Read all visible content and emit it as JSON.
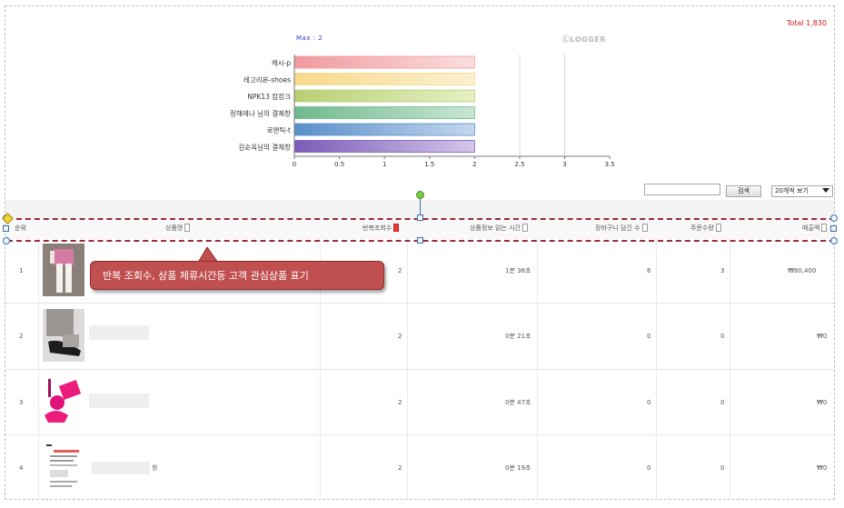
{
  "header": {
    "total": "Total 1,830",
    "max": "Max : 2",
    "logo": "LOGGER"
  },
  "chart_data": {
    "type": "bar",
    "orientation": "horizontal",
    "categories": [
      "캐시-p",
      "레고리본-shoes",
      "NPK13 캄캉크",
      "장해레나 님의 결제창",
      "로맨틱-t",
      "김순옥님의 결제창"
    ],
    "values": [
      2,
      2,
      2,
      2,
      2,
      2
    ],
    "xticks": [
      "0",
      "0.5",
      "1",
      "1.5",
      "2",
      "2.5",
      "3",
      "3.5"
    ],
    "xlim": [
      0,
      3.5
    ],
    "colors": [
      [
        "#f09a9e",
        "#fbdede"
      ],
      [
        "#f7d98a",
        "#fcf0cf"
      ],
      [
        "#b9cf73",
        "#e5efc3"
      ],
      [
        "#6fb98d",
        "#c9e6d3"
      ],
      [
        "#5a8ec9",
        "#c3d7ee"
      ],
      [
        "#7a5bb8",
        "#d5c7ea"
      ]
    ]
  },
  "controls": {
    "search_value": "",
    "search_button": "검색",
    "view_select": "20개씩 보기"
  },
  "table": {
    "columns": [
      "순위",
      "상품명",
      "반복조회수",
      "상품정보 읽는 시간",
      "장바구니 담긴 수",
      "주문수량",
      "매출액"
    ],
    "rows": [
      {
        "rank": "1",
        "name": "",
        "views": "2",
        "time": "1분 36초",
        "cart": "6",
        "orders": "3",
        "sales": "₩80,400"
      },
      {
        "rank": "2",
        "name": "",
        "views": "2",
        "time": "0분 21초",
        "cart": "0",
        "orders": "0",
        "sales": "₩0"
      },
      {
        "rank": "3",
        "name": "",
        "views": "2",
        "time": "0분 47초",
        "cart": "0",
        "orders": "0",
        "sales": "₩0"
      },
      {
        "rank": "4",
        "name": "창",
        "views": "2",
        "time": "0분 19초",
        "cart": "0",
        "orders": "0",
        "sales": "₩0"
      }
    ]
  },
  "callout": {
    "text": "반복 조회수, 상품 체류시간등 고객 관심상품 표기"
  }
}
